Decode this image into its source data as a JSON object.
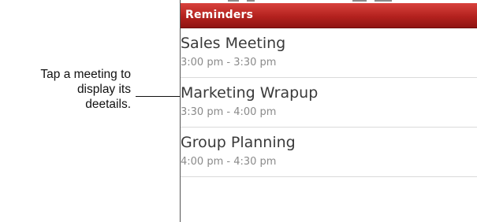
{
  "callout": {
    "lines": [
      "Tap a meeting to",
      "display its",
      "deetails."
    ]
  },
  "app": {
    "title": "Reminders",
    "accent_color": "#b3211e"
  },
  "reminders": [
    {
      "title": "Sales Meeting",
      "time": "3:00 pm - 3:30 pm"
    },
    {
      "title": "Marketing Wrapup",
      "time": "3:30 pm - 4:00 pm"
    },
    {
      "title": "Group Planning",
      "time": "4:00 pm - 4:30 pm"
    }
  ]
}
